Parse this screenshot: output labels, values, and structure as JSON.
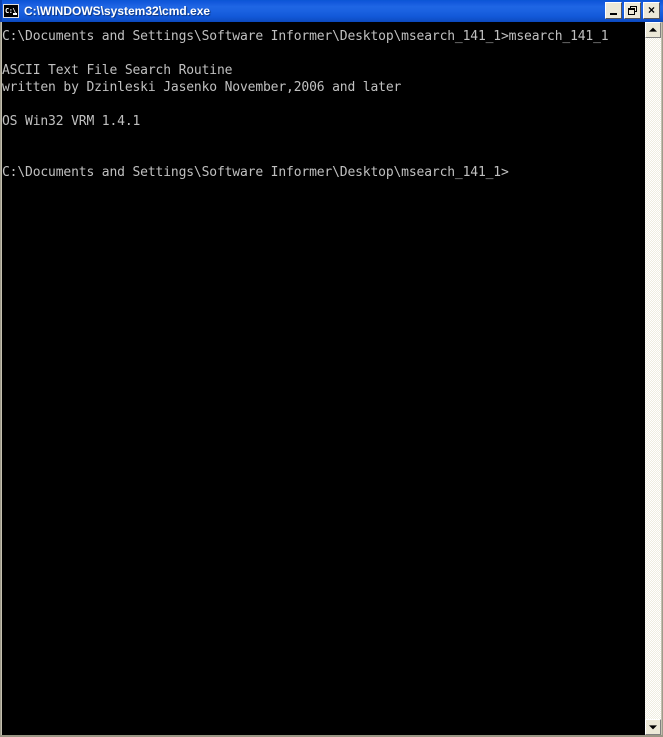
{
  "window": {
    "title": "C:\\WINDOWS\\system32\\cmd.exe",
    "icon_name": "cmd-console-icon",
    "icon_glyph": "C:\\",
    "titlebar_color": "#1A61E0",
    "client_background": "#000000",
    "client_foreground": "#C0C0C0",
    "controls": {
      "minimize_label": "",
      "restore_label": "",
      "close_label": "×"
    }
  },
  "console": {
    "lines": [
      "C:\\Documents and Settings\\Software Informer\\Desktop\\msearch_141_1>msearch_141_1",
      "",
      "ASCII Text File Search Routine",
      "written by Dzinleski Jasenko November,2006 and later",
      "",
      "OS Win32 VRM 1.4.1",
      "",
      "",
      "C:\\Documents and Settings\\Software Informer\\Desktop\\msearch_141_1>"
    ],
    "text": "C:\\Documents and Settings\\Software Informer\\Desktop\\msearch_141_1>msearch_141_1\n\nASCII Text File Search Routine\nwritten by Dzinleski Jasenko November,2006 and later\n\nOS Win32 VRM 1.4.1\n\n\nC:\\Documents and Settings\\Software Informer\\Desktop\\msearch_141_1>",
    "current_directory": "C:\\Documents and Settings\\Software Informer\\Desktop\\msearch_141_1",
    "command_entered": "msearch_141_1",
    "program_name": "ASCII Text File Search Routine",
    "program_author": "Dzinleski Jasenko",
    "program_date": "November,2006 and later",
    "program_platform": "OS Win32",
    "program_version": "VRM 1.4.1"
  },
  "scrollbar": {
    "up_arrow_name": "scroll-up-arrow",
    "down_arrow_name": "scroll-down-arrow"
  }
}
